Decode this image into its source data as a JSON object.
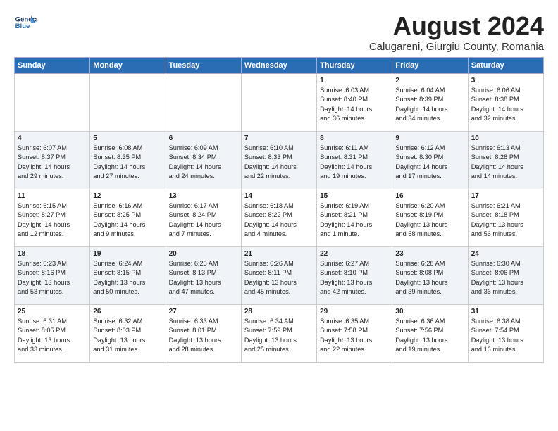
{
  "header": {
    "logo_line1": "General",
    "logo_line2": "Blue",
    "title": "August 2024",
    "subtitle": "Calugareni, Giurgiu County, Romania"
  },
  "weekdays": [
    "Sunday",
    "Monday",
    "Tuesday",
    "Wednesday",
    "Thursday",
    "Friday",
    "Saturday"
  ],
  "weeks": [
    [
      {
        "day": "",
        "info": ""
      },
      {
        "day": "",
        "info": ""
      },
      {
        "day": "",
        "info": ""
      },
      {
        "day": "",
        "info": ""
      },
      {
        "day": "1",
        "info": "Sunrise: 6:03 AM\nSunset: 8:40 PM\nDaylight: 14 hours\nand 36 minutes."
      },
      {
        "day": "2",
        "info": "Sunrise: 6:04 AM\nSunset: 8:39 PM\nDaylight: 14 hours\nand 34 minutes."
      },
      {
        "day": "3",
        "info": "Sunrise: 6:06 AM\nSunset: 8:38 PM\nDaylight: 14 hours\nand 32 minutes."
      }
    ],
    [
      {
        "day": "4",
        "info": "Sunrise: 6:07 AM\nSunset: 8:37 PM\nDaylight: 14 hours\nand 29 minutes."
      },
      {
        "day": "5",
        "info": "Sunrise: 6:08 AM\nSunset: 8:35 PM\nDaylight: 14 hours\nand 27 minutes."
      },
      {
        "day": "6",
        "info": "Sunrise: 6:09 AM\nSunset: 8:34 PM\nDaylight: 14 hours\nand 24 minutes."
      },
      {
        "day": "7",
        "info": "Sunrise: 6:10 AM\nSunset: 8:33 PM\nDaylight: 14 hours\nand 22 minutes."
      },
      {
        "day": "8",
        "info": "Sunrise: 6:11 AM\nSunset: 8:31 PM\nDaylight: 14 hours\nand 19 minutes."
      },
      {
        "day": "9",
        "info": "Sunrise: 6:12 AM\nSunset: 8:30 PM\nDaylight: 14 hours\nand 17 minutes."
      },
      {
        "day": "10",
        "info": "Sunrise: 6:13 AM\nSunset: 8:28 PM\nDaylight: 14 hours\nand 14 minutes."
      }
    ],
    [
      {
        "day": "11",
        "info": "Sunrise: 6:15 AM\nSunset: 8:27 PM\nDaylight: 14 hours\nand 12 minutes."
      },
      {
        "day": "12",
        "info": "Sunrise: 6:16 AM\nSunset: 8:25 PM\nDaylight: 14 hours\nand 9 minutes."
      },
      {
        "day": "13",
        "info": "Sunrise: 6:17 AM\nSunset: 8:24 PM\nDaylight: 14 hours\nand 7 minutes."
      },
      {
        "day": "14",
        "info": "Sunrise: 6:18 AM\nSunset: 8:22 PM\nDaylight: 14 hours\nand 4 minutes."
      },
      {
        "day": "15",
        "info": "Sunrise: 6:19 AM\nSunset: 8:21 PM\nDaylight: 14 hours\nand 1 minute."
      },
      {
        "day": "16",
        "info": "Sunrise: 6:20 AM\nSunset: 8:19 PM\nDaylight: 13 hours\nand 58 minutes."
      },
      {
        "day": "17",
        "info": "Sunrise: 6:21 AM\nSunset: 8:18 PM\nDaylight: 13 hours\nand 56 minutes."
      }
    ],
    [
      {
        "day": "18",
        "info": "Sunrise: 6:23 AM\nSunset: 8:16 PM\nDaylight: 13 hours\nand 53 minutes."
      },
      {
        "day": "19",
        "info": "Sunrise: 6:24 AM\nSunset: 8:15 PM\nDaylight: 13 hours\nand 50 minutes."
      },
      {
        "day": "20",
        "info": "Sunrise: 6:25 AM\nSunset: 8:13 PM\nDaylight: 13 hours\nand 47 minutes."
      },
      {
        "day": "21",
        "info": "Sunrise: 6:26 AM\nSunset: 8:11 PM\nDaylight: 13 hours\nand 45 minutes."
      },
      {
        "day": "22",
        "info": "Sunrise: 6:27 AM\nSunset: 8:10 PM\nDaylight: 13 hours\nand 42 minutes."
      },
      {
        "day": "23",
        "info": "Sunrise: 6:28 AM\nSunset: 8:08 PM\nDaylight: 13 hours\nand 39 minutes."
      },
      {
        "day": "24",
        "info": "Sunrise: 6:30 AM\nSunset: 8:06 PM\nDaylight: 13 hours\nand 36 minutes."
      }
    ],
    [
      {
        "day": "25",
        "info": "Sunrise: 6:31 AM\nSunset: 8:05 PM\nDaylight: 13 hours\nand 33 minutes."
      },
      {
        "day": "26",
        "info": "Sunrise: 6:32 AM\nSunset: 8:03 PM\nDaylight: 13 hours\nand 31 minutes."
      },
      {
        "day": "27",
        "info": "Sunrise: 6:33 AM\nSunset: 8:01 PM\nDaylight: 13 hours\nand 28 minutes."
      },
      {
        "day": "28",
        "info": "Sunrise: 6:34 AM\nSunset: 7:59 PM\nDaylight: 13 hours\nand 25 minutes."
      },
      {
        "day": "29",
        "info": "Sunrise: 6:35 AM\nSunset: 7:58 PM\nDaylight: 13 hours\nand 22 minutes."
      },
      {
        "day": "30",
        "info": "Sunrise: 6:36 AM\nSunset: 7:56 PM\nDaylight: 13 hours\nand 19 minutes."
      },
      {
        "day": "31",
        "info": "Sunrise: 6:38 AM\nSunset: 7:54 PM\nDaylight: 13 hours\nand 16 minutes."
      }
    ]
  ]
}
